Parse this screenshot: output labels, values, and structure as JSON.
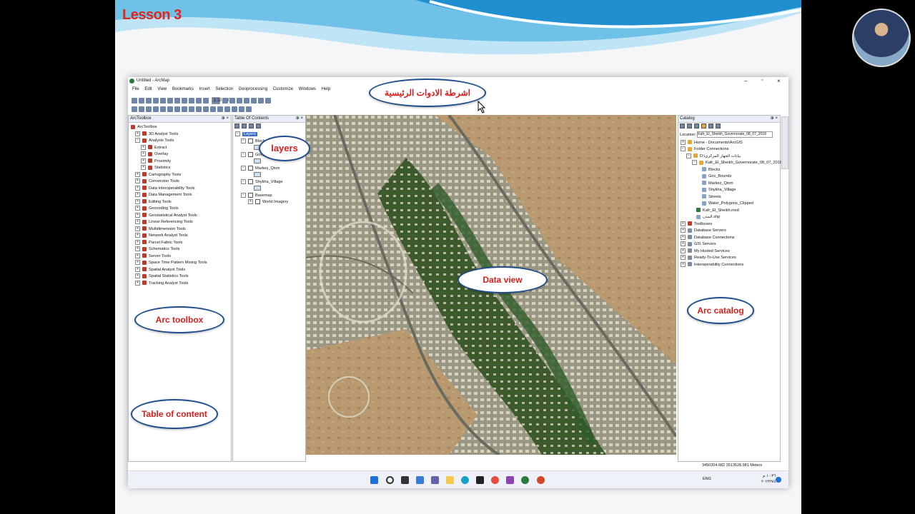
{
  "slide": {
    "lesson": "Lesson 3"
  },
  "window": {
    "title": "Untitled - ArcMap",
    "menus": [
      "File",
      "Edit",
      "View",
      "Bookmarks",
      "Insert",
      "Selection",
      "Geoprocessing",
      "Customize",
      "Windows",
      "Help"
    ],
    "scale": "1:10,000"
  },
  "toolbox": {
    "title": "ArcToolbox",
    "root": "ArcToolbox",
    "items": [
      "3D Analyst Tools",
      "Analysis Tools",
      "Extract",
      "Overlay",
      "Proximity",
      "Statistics",
      "Cartography Tools",
      "Conversion Tools",
      "Data Interoperability Tools",
      "Data Management Tools",
      "Editing Tools",
      "Geocoding Tools",
      "Geostatistical Analyst Tools",
      "Linear Referencing Tools",
      "Multidimension Tools",
      "Network Analyst Tools",
      "Parcel Fabric Tools",
      "Schematics Tools",
      "Server Tools",
      "Space Time Pattern Mining Tools",
      "Spatial Analyst Tools",
      "Spatial Statistics Tools",
      "Tracking Analyst Tools"
    ]
  },
  "toc": {
    "title": "Table Of Contents",
    "root": "Layers",
    "layers": [
      "Blocks",
      "Gov_Bounds",
      "Markez_Qism",
      "Shykha_Village",
      "Basemap",
      "World Imagery"
    ]
  },
  "catalog": {
    "title": "Catalog",
    "location_label": "Location:",
    "location_value": "Kafr_El_Sheikh_Governorate_08_07_2018",
    "items": [
      "Home - Documents\\ArcGIS",
      "Folder Connections",
      "D:\\بيانات الجهاز المركزي",
      "Kafr_El_Sheikh_Governorate_08_07_2018",
      "Blocks",
      "Gov_Bounds",
      "Markez_Qism",
      "Shykha_Village",
      "Streets",
      "Water_Polygons_Clipped",
      "Kafr_El_Sheikh.mxd",
      "المدن.shp",
      "Toolboxes",
      "Database Servers",
      "Database Connections",
      "GIS Servers",
      "My Hosted Services",
      "Ready-To-Use Services",
      "Interoperability Connections"
    ]
  },
  "status": {
    "coords": "3450204.682  3513528.981 Meters"
  },
  "taskbar": {
    "lang": "ENG",
    "time": "١٠:٣٦ م",
    "date": "٢٠٢٣/٩/٤"
  },
  "callouts": {
    "main_toolbar": "اشرطة الادوات الرئيسية",
    "layers": "layers",
    "data_view": "Data view",
    "arc_catalog": "Arc catalog",
    "arc_toolbox": "Arc toolbox",
    "table_of_content": "Table of content"
  }
}
